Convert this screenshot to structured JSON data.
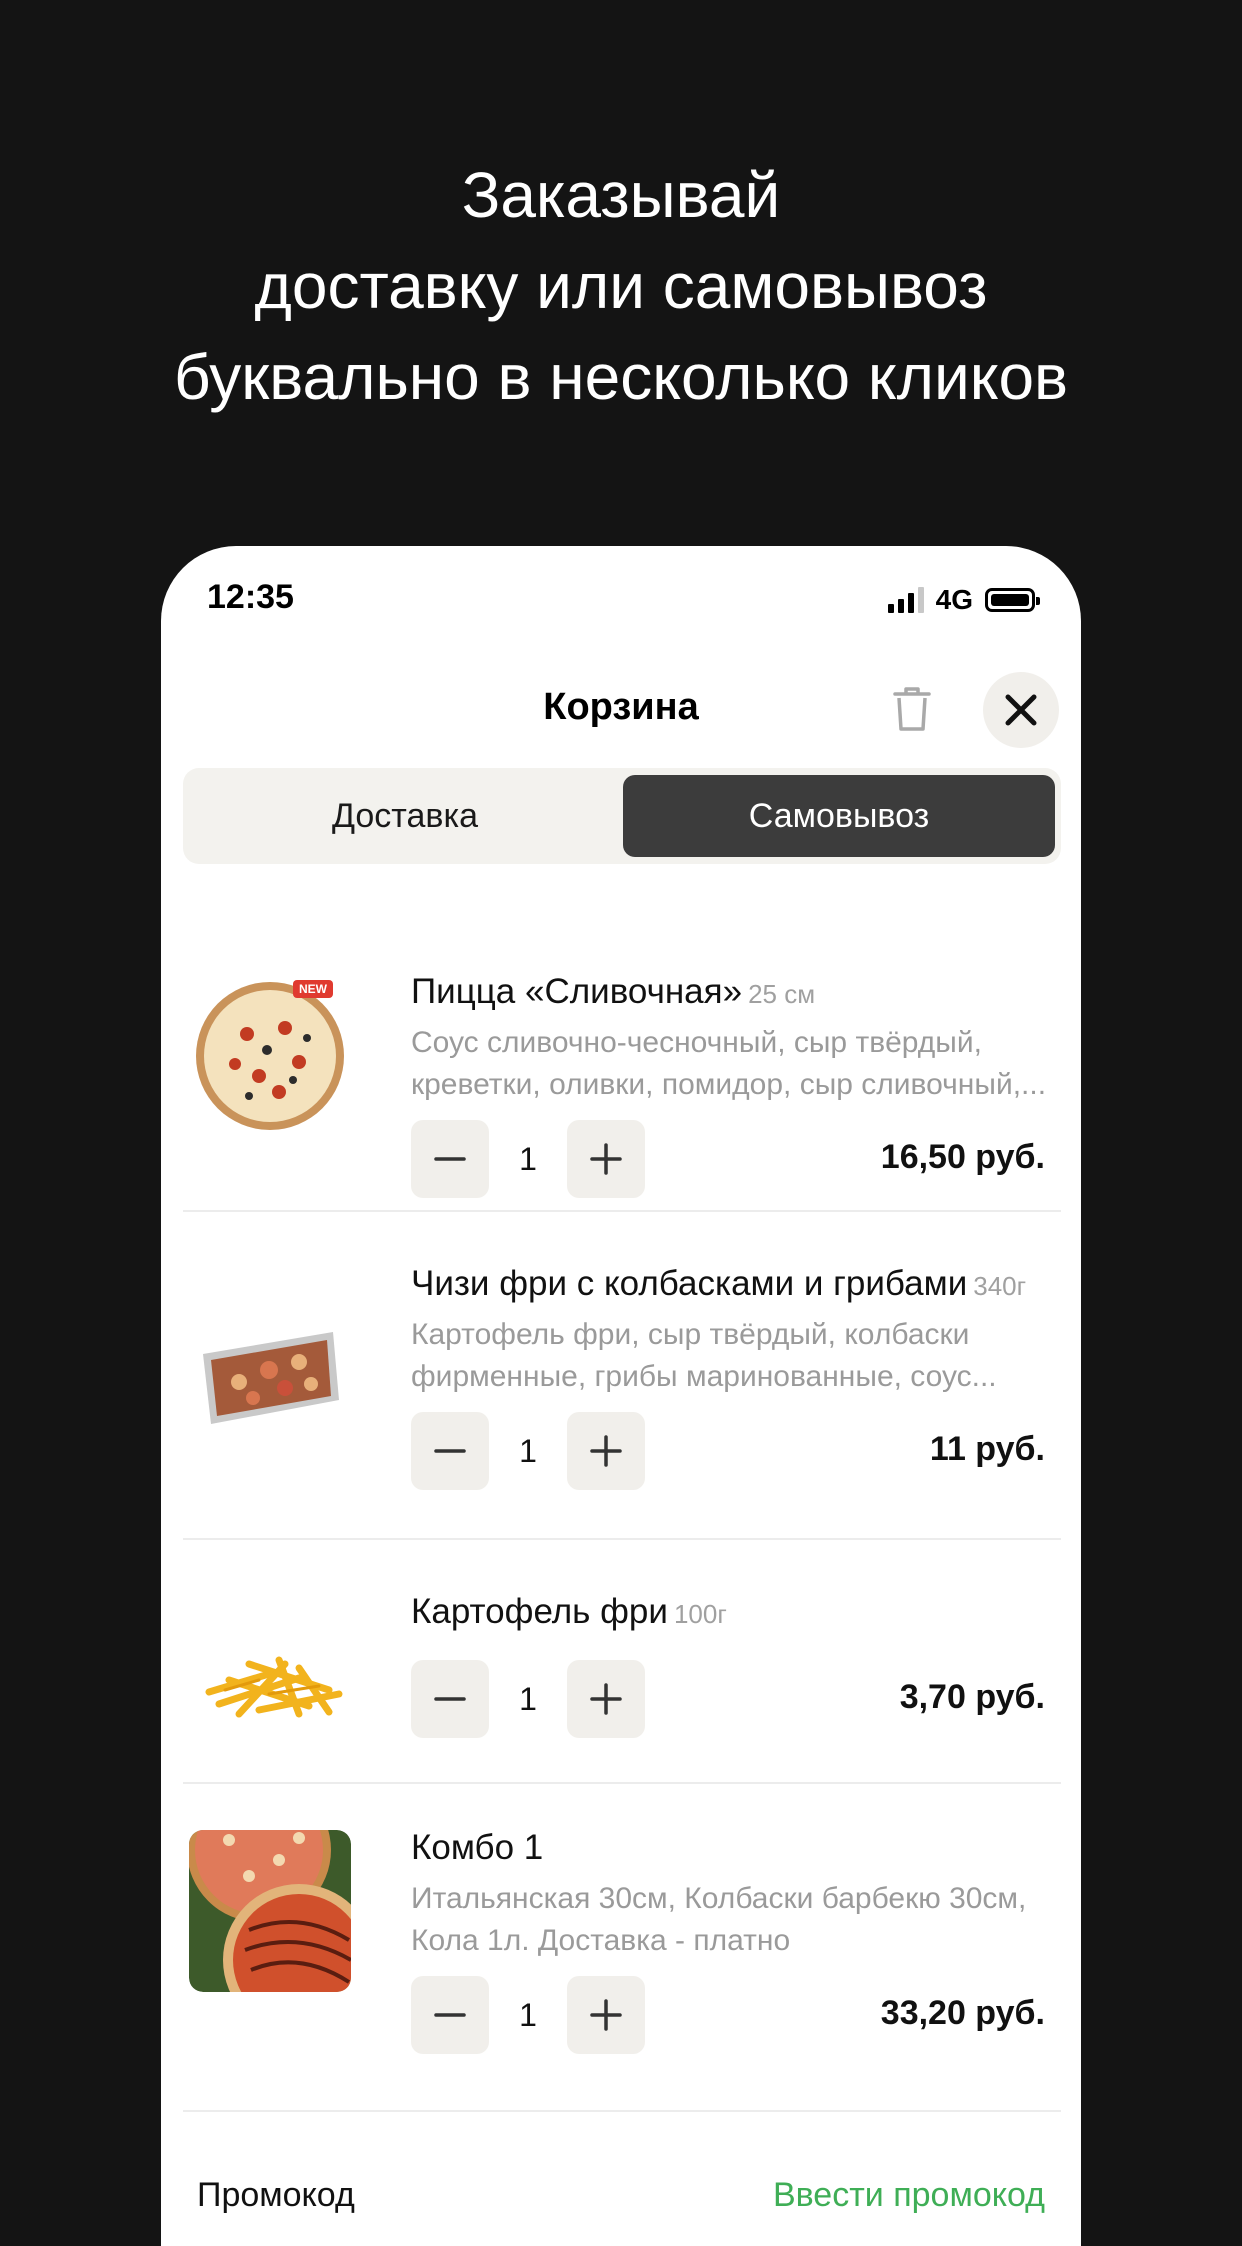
{
  "promo_heading": {
    "line1": "Заказывай",
    "line2": "доставку или самовывоз",
    "line3": "буквально в несколько кликов"
  },
  "status_bar": {
    "time": "12:35",
    "network": "4G"
  },
  "header": {
    "title": "Корзина"
  },
  "segment": {
    "delivery": "Доставка",
    "pickup": "Самовывоз",
    "selected": "pickup"
  },
  "cart": {
    "items": [
      {
        "name": "Пицца «Сливочная»",
        "weight": "25 см",
        "desc_line1": "Соус сливочно-чесночный, сыр твёрдый,",
        "desc_line2": "креветки, оливки, помидор, сыр сливочный,...",
        "badge": "NEW",
        "qty": "1",
        "price": "16,50 руб."
      },
      {
        "name": "Чизи фри с колбасками и грибами",
        "weight": "340г",
        "desc_line1": "Картофель фри, сыр твёрдый, колбаски",
        "desc_line2": "фирменные, грибы маринованные, соус...",
        "qty": "1",
        "price": "11 руб."
      },
      {
        "name": "Картофель фри",
        "weight": "100г",
        "qty": "1",
        "price": "3,70 руб."
      },
      {
        "name": "Комбо 1",
        "weight": "",
        "desc_line1": "Итальянская 30см, Колбаски барбекю 30см,",
        "desc_line2": "Кола 1л. Доставка - платно",
        "qty": "1",
        "price": "33,20 руб."
      }
    ]
  },
  "promo": {
    "label": "Промокод",
    "link": "Ввести промокод"
  },
  "colors": {
    "background": "#141414",
    "accent_green": "#3fae56",
    "segment_active": "#3c3c3c"
  }
}
